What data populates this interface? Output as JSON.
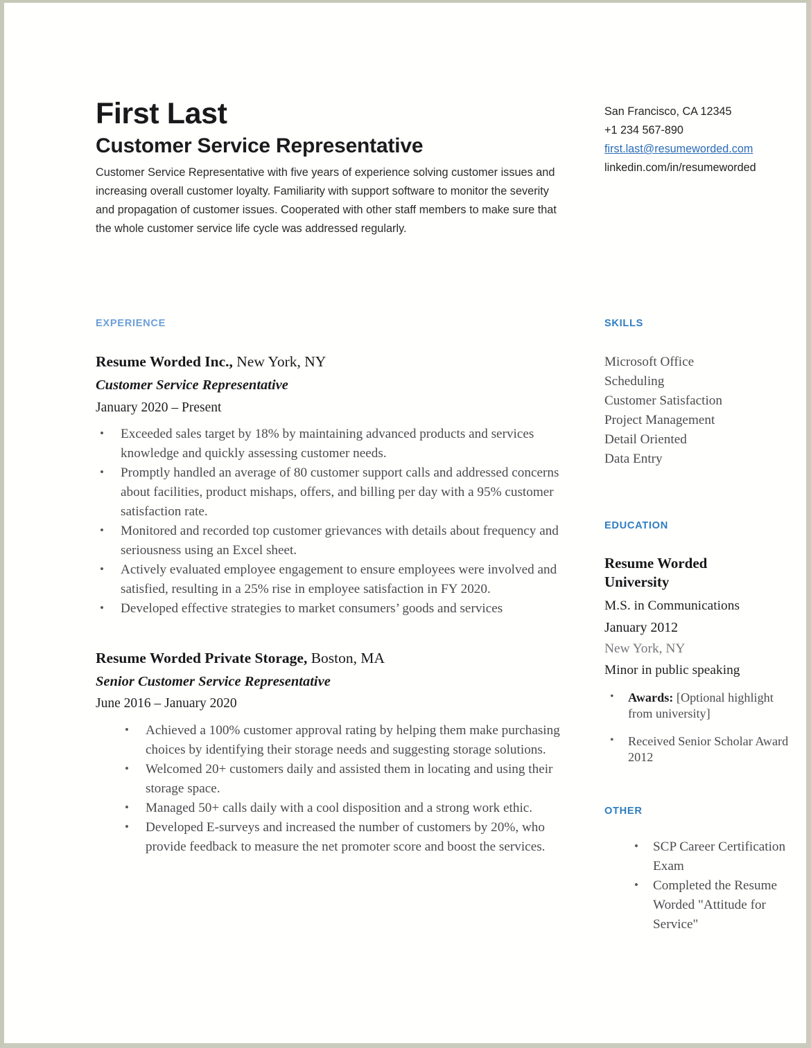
{
  "document": {
    "type": "resume",
    "accent_color": "#2e7dc2",
    "link_color": "#2b6cb8",
    "body_text_color": "#4a4a4e"
  },
  "header": {
    "name": "First Last",
    "title": "Customer Service Representative",
    "summary": "Customer Service Representative with five years of experience solving customer issues and increasing overall customer loyalty. Familiarity with support software to monitor the severity and propagation of customer issues. Cooperated with other staff members to make sure that the whole customer service life cycle was addressed regularly."
  },
  "contact": {
    "location": "San Francisco, CA 12345",
    "phone": "+1 234 567-890",
    "email": "first.last@resumeworded.com",
    "linkedin": "linkedin.com/in/resumeworded"
  },
  "experience": {
    "heading": "EXPERIENCE",
    "jobs": [
      {
        "company": "Resume Worded Inc.,",
        "location": "New York, NY",
        "role": "Customer Service Representative",
        "dates": "January 2020 – Present",
        "bullets": [
          "Exceeded sales target by 18% by maintaining advanced products and services knowledge and quickly assessing customer needs.",
          "Promptly handled an average of 80 customer support calls and addressed concerns about facilities, product mishaps, offers, and billing per day with a 95% customer satisfaction rate.",
          "Monitored and recorded top customer grievances with details about frequency and seriousness using an Excel sheet.",
          "Actively evaluated employee engagement to ensure employees were involved and satisfied, resulting in a 25% rise in employee satisfaction in FY 2020.",
          "Developed effective strategies to market consumers’ goods and services"
        ]
      },
      {
        "company": "Resume Worded Private Storage,",
        "location": "Boston, MA",
        "role": "Senior Customer Service Representative",
        "dates": "June 2016 – January 2020",
        "bullets": [
          "Achieved a 100% customer approval rating by helping them make purchasing choices by identifying their storage needs and suggesting storage solutions.",
          "Welcomed 20+ customers daily and assisted them in locating and using their storage space.",
          "Managed 50+ calls daily with a cool disposition and a strong work ethic.",
          "Developed E-surveys and increased the number of customers by 20%, who provide feedback to measure the net promoter score and boost the services."
        ]
      }
    ]
  },
  "skills": {
    "heading": "SKILLS",
    "items": [
      "Microsoft Office",
      "Scheduling",
      "Customer Satisfaction",
      "Project Management",
      "Detail Oriented",
      "Data Entry"
    ]
  },
  "education": {
    "heading": "EDUCATION",
    "school": "Resume Worded University",
    "degree": "M.S. in Communications",
    "date": "January 2012",
    "location": "New York, NY",
    "minor": "Minor in public speaking",
    "bullets": [
      {
        "label": "Awards:",
        "text": " [Optional highlight from university]"
      },
      {
        "label": "",
        "text": "Received Senior Scholar Award 2012"
      }
    ]
  },
  "other": {
    "heading": "OTHER",
    "items": [
      "SCP Career Certification Exam",
      "Completed the Resume Worded \"Attitude for Service\""
    ]
  }
}
